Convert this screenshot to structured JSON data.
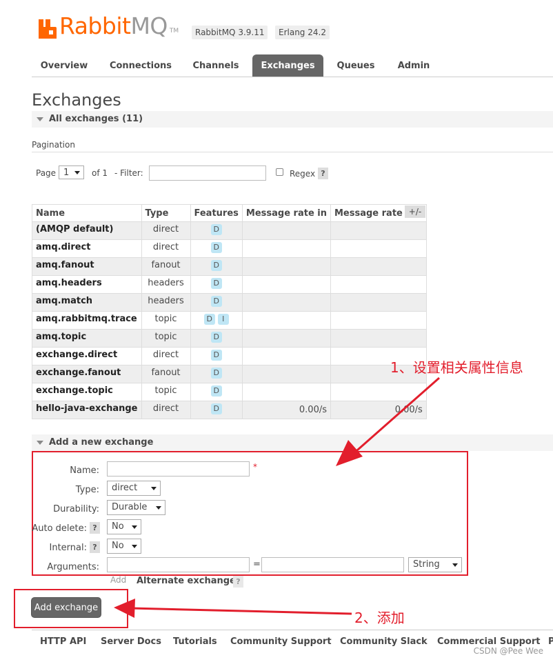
{
  "brand": {
    "name_a": "Rabbit",
    "name_b": "MQ",
    "tm": "TM",
    "color": "#ff6600"
  },
  "versions": [
    "RabbitMQ 3.9.11",
    "Erlang 24.2"
  ],
  "tabs": [
    {
      "label": "Overview",
      "active": false
    },
    {
      "label": "Connections",
      "active": false
    },
    {
      "label": "Channels",
      "active": false
    },
    {
      "label": "Exchanges",
      "active": true
    },
    {
      "label": "Queues",
      "active": false
    },
    {
      "label": "Admin",
      "active": false
    }
  ],
  "page_title": "Exchanges",
  "all_section": "All exchanges (11)",
  "pagination": {
    "heading": "Pagination",
    "page_label": "Page",
    "page_value": "1",
    "of_label": "of 1",
    "filter_label": "- Filter:",
    "filter_value": "",
    "regex_label": "Regex",
    "help": "?"
  },
  "table": {
    "headers": [
      "Name",
      "Type",
      "Features",
      "Message rate in",
      "Message rate out"
    ],
    "plus_minus": "+/-",
    "rows": [
      {
        "name": "(AMQP default)",
        "type": "direct",
        "features": [
          "D"
        ],
        "rate_in": "",
        "rate_out": ""
      },
      {
        "name": "amq.direct",
        "type": "direct",
        "features": [
          "D"
        ],
        "rate_in": "",
        "rate_out": ""
      },
      {
        "name": "amq.fanout",
        "type": "fanout",
        "features": [
          "D"
        ],
        "rate_in": "",
        "rate_out": ""
      },
      {
        "name": "amq.headers",
        "type": "headers",
        "features": [
          "D"
        ],
        "rate_in": "",
        "rate_out": ""
      },
      {
        "name": "amq.match",
        "type": "headers",
        "features": [
          "D"
        ],
        "rate_in": "",
        "rate_out": ""
      },
      {
        "name": "amq.rabbitmq.trace",
        "type": "topic",
        "features": [
          "D",
          "I"
        ],
        "rate_in": "",
        "rate_out": ""
      },
      {
        "name": "amq.topic",
        "type": "topic",
        "features": [
          "D"
        ],
        "rate_in": "",
        "rate_out": ""
      },
      {
        "name": "exchange.direct",
        "type": "direct",
        "features": [
          "D"
        ],
        "rate_in": "",
        "rate_out": ""
      },
      {
        "name": "exchange.fanout",
        "type": "fanout",
        "features": [
          "D"
        ],
        "rate_in": "",
        "rate_out": ""
      },
      {
        "name": "exchange.topic",
        "type": "topic",
        "features": [
          "D"
        ],
        "rate_in": "",
        "rate_out": ""
      },
      {
        "name": "hello-java-exchange",
        "type": "direct",
        "features": [
          "D"
        ],
        "rate_in": "0.00/s",
        "rate_out": "0.00/s"
      }
    ]
  },
  "add_section": "Add a new exchange",
  "form": {
    "name_label": "Name:",
    "name_value": "",
    "required_mark": "*",
    "type_label": "Type:",
    "type_value": "direct",
    "durability_label": "Durability:",
    "durability_value": "Durable",
    "auto_delete_label": "Auto delete:",
    "auto_delete_value": "No",
    "internal_label": "Internal:",
    "internal_value": "No",
    "arguments_label": "Arguments:",
    "arg_key": "",
    "equals": "=",
    "arg_value": "",
    "arg_type": "String",
    "add_link": "Add",
    "alternate_exchange": "Alternate exchange",
    "help": "?"
  },
  "add_button": "Add exchange",
  "annotations": {
    "note1": "1、设置相关属性信息",
    "note2": "2、添加",
    "color": "#e21e2c"
  },
  "footer": [
    "HTTP API",
    "Server Docs",
    "Tutorials",
    "Community Support",
    "Community Slack",
    "Commercial Support",
    "P"
  ],
  "watermark": "CSDN @Pee Wee"
}
